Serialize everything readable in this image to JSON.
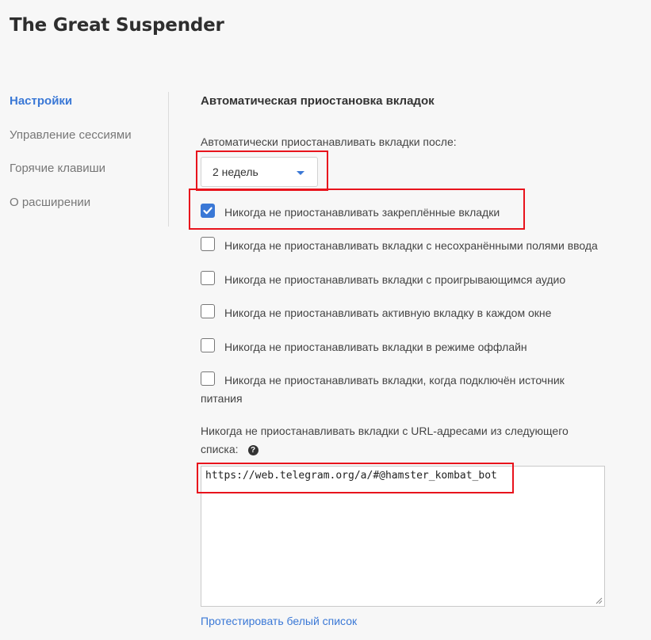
{
  "app": {
    "title": "The Great Suspender"
  },
  "sidebar": {
    "items": [
      {
        "label": "Настройки",
        "active": true
      },
      {
        "label": "Управление сессиями",
        "active": false
      },
      {
        "label": "Горячие клавиши",
        "active": false
      },
      {
        "label": "О расширении",
        "active": false
      }
    ]
  },
  "main": {
    "section_title": "Автоматическая приостановка вкладок",
    "suspend_after_label": "Автоматически приостанавливать вкладки после:",
    "suspend_after_value": "2 недель",
    "options": [
      {
        "label": "Никогда не приостанавливать закреплённые вкладки",
        "checked": true
      },
      {
        "label": "Никогда не приостанавливать вкладки с несохранёнными полями ввода",
        "checked": false
      },
      {
        "label": "Никогда не приостанавливать вкладки с проигрывающимся аудио",
        "checked": false
      },
      {
        "label": "Никогда не приостанавливать активную вкладку в каждом окне",
        "checked": false
      },
      {
        "label": "Никогда не приостанавливать вкладки в режиме оффлайн",
        "checked": false
      },
      {
        "label_line1": "Никогда не приостанавливать вкладки, когда подключён источник",
        "label_line2": "питания",
        "checked": false
      }
    ],
    "whitelist_label_line1": "Никогда не приостанавливать вкладки с URL-адресами из следующего",
    "whitelist_label_line2": "списка:",
    "whitelist_value": "https://web.telegram.org/a/#@hamster_kombat_bot",
    "test_whitelist_link": "Протестировать белый список"
  },
  "colors": {
    "accent": "#3a78d6",
    "highlight": "#e8131c"
  }
}
